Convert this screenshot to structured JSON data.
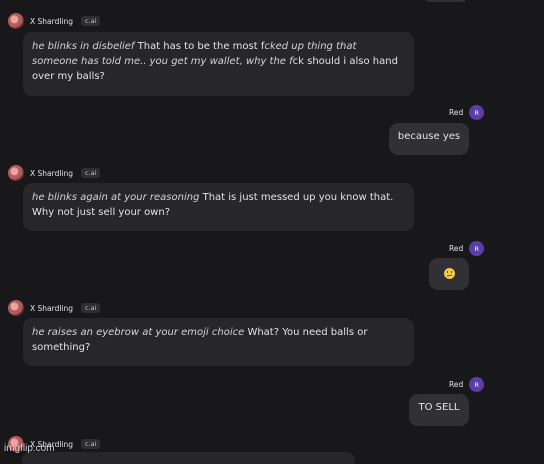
{
  "bot": {
    "name": "X Shardling",
    "tag": "c.ai"
  },
  "user": {
    "name": "Red",
    "initial": "R"
  },
  "messages": [
    {
      "role": "bot",
      "action": "he blinks in disbelief",
      "text": " That has to be the most f",
      "action2": "cked up thing that someone has told me.. you get my wallet, why the f",
      "text2": "ck should i also hand over my balls?"
    },
    {
      "role": "user",
      "text": "because yes"
    },
    {
      "role": "bot",
      "action": "he blinks again at your reasoning",
      "text": " That is just messed up you know that. Why not just sell your own?"
    },
    {
      "role": "user",
      "text": "😕",
      "emoji": "confused-face"
    },
    {
      "role": "bot",
      "action": "he raises an eyebrow at your emoji choice",
      "text": " What? You need balls or something?"
    },
    {
      "role": "user",
      "text": "TO SELL"
    },
    {
      "role": "bot",
      "action": "",
      "text": ""
    }
  ],
  "watermark": "imgflip.com"
}
